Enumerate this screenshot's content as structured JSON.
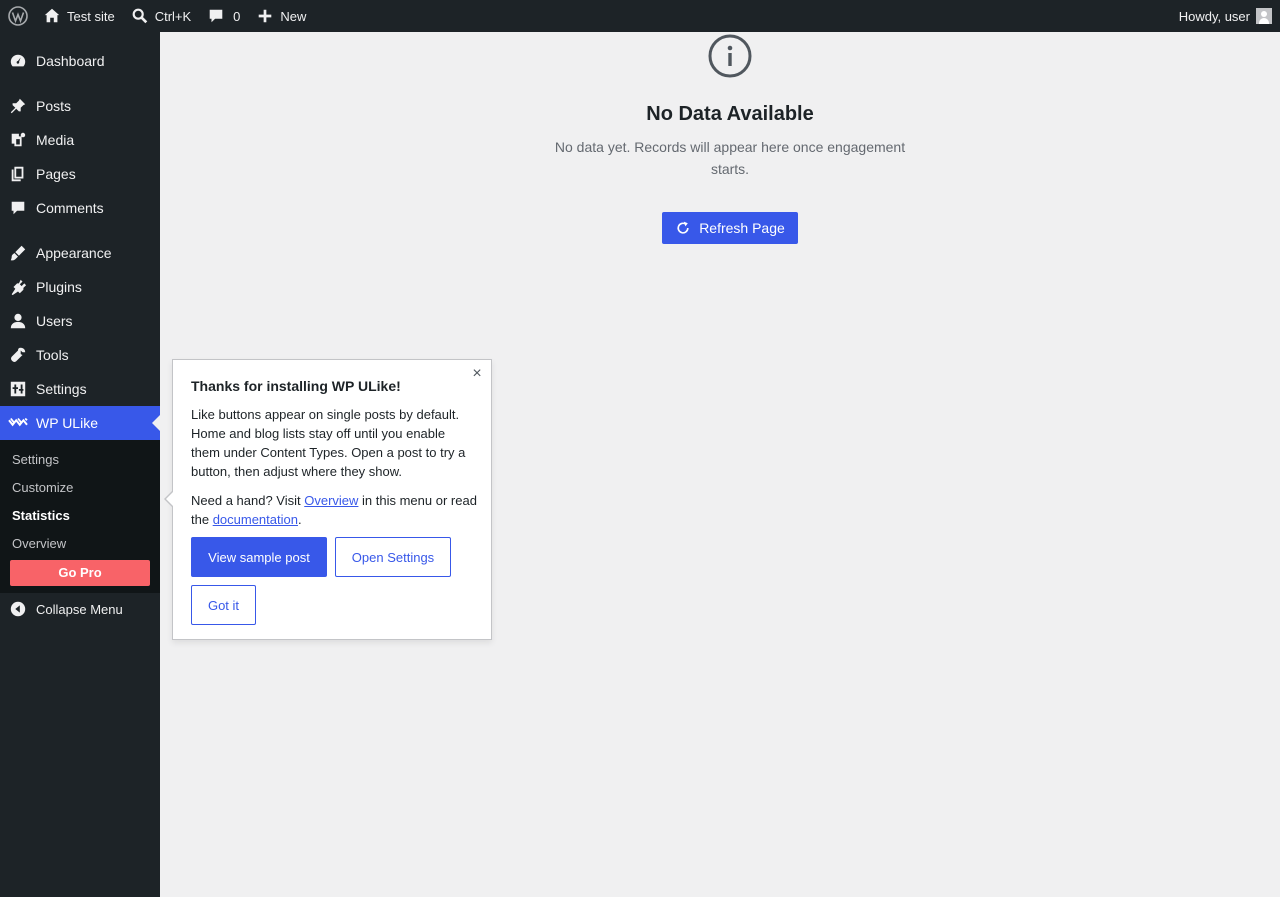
{
  "adminbar": {
    "site_name": "Test site",
    "search_shortcut": "Ctrl+K",
    "comments_count": "0",
    "new_label": "New",
    "greeting": "Howdy, user",
    "icons": [
      "wordpress-logo-icon",
      "home-icon",
      "search-icon",
      "comment-icon",
      "plus-icon"
    ]
  },
  "sidebar": {
    "items": [
      {
        "label": "Dashboard",
        "icon": "dashboard-icon"
      },
      {
        "label": "Posts",
        "icon": "pin-icon"
      },
      {
        "label": "Media",
        "icon": "media-icon"
      },
      {
        "label": "Pages",
        "icon": "pages-icon"
      },
      {
        "label": "Comments",
        "icon": "comment-icon"
      },
      {
        "label": "Appearance",
        "icon": "brush-icon"
      },
      {
        "label": "Plugins",
        "icon": "plugin-icon"
      },
      {
        "label": "Users",
        "icon": "user-icon"
      },
      {
        "label": "Tools",
        "icon": "wrench-icon"
      },
      {
        "label": "Settings",
        "icon": "sliders-icon"
      },
      {
        "label": "WP ULike",
        "icon": "wpulike-icon"
      }
    ],
    "submenu": [
      "Settings",
      "Customize",
      "Statistics",
      "Overview"
    ],
    "submenu_current": "Statistics",
    "go_pro": "Go Pro",
    "collapse": "Collapse Menu"
  },
  "main": {
    "title": "No Data Available",
    "description": "No data yet. Records will appear here once engagement starts.",
    "refresh_label": "Refresh Page"
  },
  "pointer": {
    "title": "Thanks for installing WP ULike!",
    "body": "Like buttons appear on single posts by default. Home and blog lists stay off until you enable them under Content Types. Open a post to try a button, then adjust where they show.",
    "help_prefix": "Need a hand? Visit ",
    "help_link1": "Overview",
    "help_middle": " in this menu or read the ",
    "help_link2": "documentation",
    "help_suffix": ".",
    "close_symbol": "×",
    "buttons": {
      "sample": "View sample post",
      "settings": "Open Settings",
      "gotit": "Got it"
    }
  },
  "colors": {
    "accent": "#3858e9",
    "admin_dark": "#1d2327",
    "submenu_bg": "#101517",
    "go_pro": "#f86368"
  }
}
